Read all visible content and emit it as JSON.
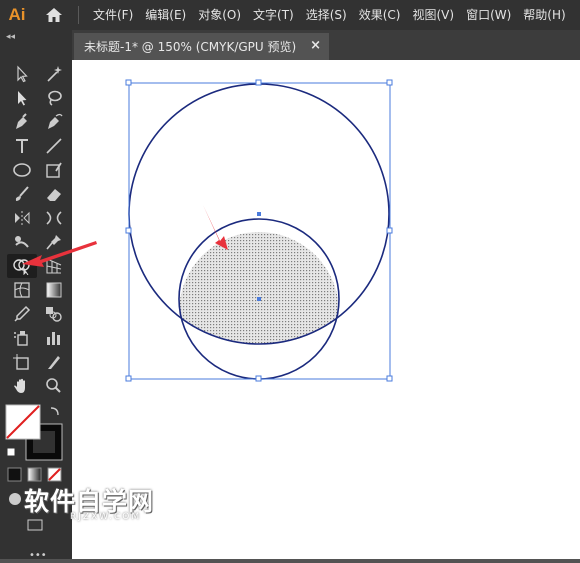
{
  "app": {
    "logo": "Ai"
  },
  "menu": [
    "文件(F)",
    "编辑(E)",
    "对象(O)",
    "文字(T)",
    "选择(S)",
    "效果(C)",
    "视图(V)",
    "窗口(W)",
    "帮助(H)"
  ],
  "document": {
    "tab_title": "未标题-1* @ 150% (CMYK/GPU 预览)",
    "close_glyph": "×"
  },
  "toolbar": {
    "collapse_glyph": "◂◂"
  },
  "watermark": {
    "title": "软件自学网",
    "subtitle": "RJZXW.COM"
  },
  "colors": {
    "stroke": "#1b2a7e",
    "selection": "#4a7bdc",
    "arrow": "#e8323c",
    "fill": "#dcdcdc"
  }
}
